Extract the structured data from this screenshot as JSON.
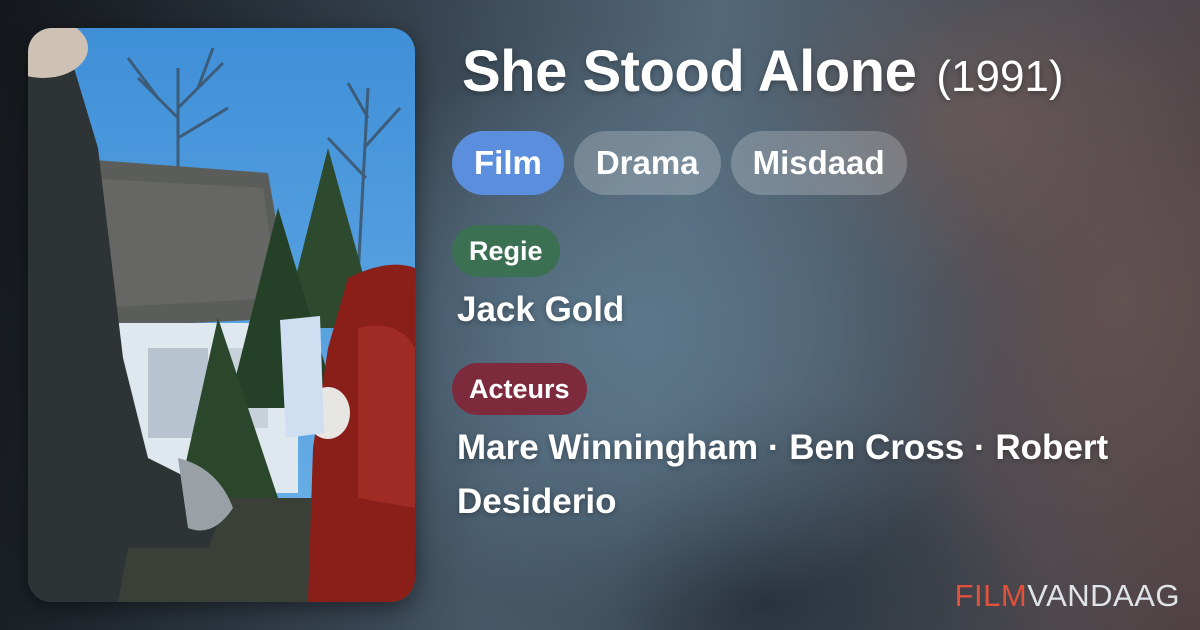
{
  "movie": {
    "title": "She Stood Alone",
    "year": "(1991)"
  },
  "tags": [
    {
      "label": "Film"
    },
    {
      "label": "Drama"
    },
    {
      "label": "Misdaad"
    }
  ],
  "credits": {
    "director_label": "Regie",
    "director": "Jack Gold",
    "cast_label": "Acteurs",
    "cast": "Mare Winningham · Ben Cross · Robert Desiderio"
  },
  "brand": {
    "part1": "FILM",
    "part2": "VANDAAG"
  },
  "colors": {
    "primary_tag": "#5b8fde",
    "director_badge": "#3c7053",
    "cast_badge": "#7e2a3d",
    "brand_accent": "#e0523c"
  }
}
